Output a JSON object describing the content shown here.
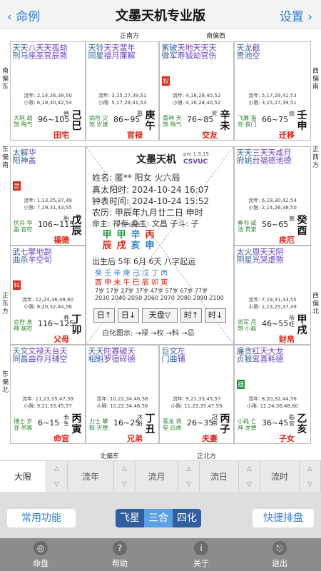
{
  "topbar": {
    "back_label": "‹ 命例",
    "title": "文墨天机专业版",
    "settings_label": "设置 ›"
  },
  "directions": {
    "top_center": "正南方",
    "top_right": "南偏西",
    "left_top": "南偏东",
    "left_mid": "东偏南",
    "left_low": "正东方",
    "left_bottom": "东偏北",
    "right_top": "西偏南",
    "right_mid": "正西方",
    "right_low": "西偏北",
    "bottom_left": "北偏东",
    "bottom_center": "正北方"
  },
  "palaces": [
    {
      "stars": [
        [
          "天",
          "刑"
        ],
        [
          "天",
          "马"
        ],
        [
          "八",
          "座"
        ],
        [
          "天",
          "巫"
        ],
        [
          "天",
          "官"
        ],
        [
          "孤",
          "辰"
        ],
        [
          "劫",
          "煞"
        ]
      ],
      "minor": "大耗 劫煞 晦气",
      "info1": "流年: 2,14,26,38,50",
      "info2": "小限: 6,18,30,42,54",
      "range": "96~105",
      "gz": [
        "己",
        "巳"
      ],
      "ll": "绝",
      "name": "田宅"
    },
    {
      "stars": [
        [
          "天",
          "同"
        ],
        [
          "铃",
          "星"
        ],
        [
          "天",
          "福"
        ],
        [
          "天",
          "月"
        ],
        [
          "蜚",
          "廉"
        ],
        [
          "年",
          "解"
        ]
      ],
      "minor": "病符 灾煞 岁建",
      "info1": "流年: 3,15,27,39,51",
      "info2": "小限: 5,17,29,41,53",
      "range": "86~95",
      "gz": [
        "庚",
        "午"
      ],
      "ll": "墓",
      "name": "官禄"
    },
    {
      "stars": [
        [
          "紫",
          "微"
        ],
        [
          "破",
          "军"
        ],
        [
          "天",
          "寿"
        ],
        [
          "地",
          "钺"
        ],
        [
          "天",
          "劫"
        ],
        [
          "天",
          "官"
        ],
        [
          "天",
          "伤"
        ]
      ],
      "hua": "权",
      "minor": "喜神 天煞 晦气",
      "info1": "流年: 4,16,28,40,52",
      "info2": "小限: 4,16,28,40,52",
      "range": "76~85",
      "gz": [
        "辛",
        "未"
      ],
      "ll": "死",
      "name": "交友"
    },
    {
      "stars": [
        [
          "天",
          "贵"
        ],
        [
          "龙",
          "池"
        ],
        [
          "截",
          "空"
        ]
      ],
      "minor": "飞廉 指背 丧门",
      "info1": "流年: 5,17,29,41,53",
      "info2": "小限: 3,15,27,39,51",
      "range": "66~75",
      "gz": [
        "壬",
        "申"
      ],
      "ll": "病",
      "name": "迁移"
    },
    {
      "stars": [
        [
          "太",
          "阳"
        ],
        [
          "解",
          "神"
        ],
        [
          "华",
          "盖"
        ]
      ],
      "hua": "忌",
      "minor": "伏兵 华盖 官符",
      "info1": "流年: 1,13,25,37,49",
      "info2": "小限: 7,19,31,43,55",
      "range": "106~115",
      "gz": [
        "戊",
        "辰"
      ],
      "ll": "胎",
      "name": "福德"
    },
    {
      "stars": [
        [
          "天",
          "府"
        ],
        [
          "天",
          "姚"
        ],
        [
          "三",
          "台"
        ],
        [
          "天",
          "福"
        ],
        [
          "天",
          "德"
        ],
        [
          "咸",
          "池"
        ],
        [
          "月",
          "德"
        ]
      ],
      "minor": "奏书 咸池 贯索",
      "info1": "流年: 6,18,30,42,54",
      "info2": "小限: 2,14,26,38,50",
      "range": "56~65",
      "gz": [
        "癸",
        "酉"
      ],
      "ll": "衰",
      "name": "疾厄"
    },
    {
      "stars": [
        [
          "武",
          "曲"
        ],
        [
          "七",
          "杀"
        ],
        [
          "擎",
          "羊"
        ],
        [
          "地",
          "空"
        ],
        [
          "副",
          "旬"
        ]
      ],
      "hua": "科",
      "minor": "官符 息神 病符",
      "info1": "流年: 12,24,36,48,60",
      "info2": "小限: 8,20,32,44,56",
      "range": "116~125",
      "gz": [
        "丁",
        "卯"
      ],
      "ll": "养",
      "name": "父母"
    },
    {
      "stars": [
        [
          "太",
          "阴"
        ],
        [
          "火",
          "星"
        ],
        [
          "恩",
          "光"
        ],
        [
          "天",
          "哭"
        ],
        [
          "天",
          "虚"
        ],
        [
          "阴",
          "煞"
        ]
      ],
      "minor": "将军 月煞 小耗",
      "info1": "流年: 7,19,31,43,55",
      "info2": "小限: 1,13,25,37,49",
      "range": "46~55",
      "gz": [
        "甲",
        "戌"
      ],
      "ll": "帝旺",
      "name": "财帛"
    },
    {
      "stars": [
        [
          "天",
          "同"
        ],
        [
          "文",
          "昌"
        ],
        [
          "文",
          "曲"
        ],
        [
          "禄",
          "存"
        ],
        [
          "天",
          "月"
        ],
        [
          "台",
          "辅"
        ],
        [
          "天",
          "空"
        ]
      ],
      "minor": "博士 岁驿 吊客",
      "info1": "流年: 11,23,35,47,59",
      "info2": "小限: 9,21,33,45,57",
      "range": "6~15",
      "gz": [
        "丙",
        "寅"
      ],
      "ll": "长生",
      "name": "命宫"
    },
    {
      "stars": [
        [
          "天",
          "相"
        ],
        [
          "天",
          "魁"
        ],
        [
          "陀",
          "罗"
        ],
        [
          "寡",
          "宿"
        ],
        [
          "破",
          "碎"
        ],
        [
          "天",
          "德"
        ]
      ],
      "minor": "力士 攀鞍 天德",
      "info1": "流年: 10,22,34,46,58",
      "info2": "小限: 10,22,34,46,58",
      "range": "16~25",
      "gz": [
        "丁",
        "丑"
      ],
      "ll": "沐浴",
      "name": "兄弟"
    },
    {
      "stars": [
        [
          "巨",
          "门"
        ],
        [
          "文",
          "曲"
        ],
        [
          "左",
          "辅"
        ]
      ],
      "minor": "青龙 将星 白虎",
      "info1": "流年: 9,21,33,45,57",
      "info2": "小限: 11,23,35,47,59",
      "range": "26~35",
      "gz": [
        "丙",
        "子"
      ],
      "ll": "冠带",
      "name": "夫妻"
    },
    {
      "stars": [
        [
          "廉",
          "贞"
        ],
        [
          "贪",
          "狼"
        ],
        [
          "红",
          "鸾"
        ],
        [
          "天",
          "喜"
        ],
        [
          "大",
          "耗"
        ],
        [
          "龙",
          "德"
        ]
      ],
      "hua": "禄",
      "minor": "小耗 亡神 龙德",
      "info1": "流年: 8,20,32,44,56",
      "info2": "小限: 12,24,36,48,60",
      "range": "36~45",
      "gz": [
        "乙",
        "亥"
      ],
      "ll": "临官",
      "name": "子女"
    }
  ],
  "center": {
    "title": "文墨天机",
    "pro": "pro 1.9.15",
    "csvuc": "CSVUC",
    "name_line": "姓名: 匿**     阳女 火六局",
    "solar_line": "真太阳时: 2024-10-24 16:07",
    "clock_line": "钟表时间: 2024-10-24 15:52",
    "lunar_line": "农历: 甲辰年九月廿二日 申时",
    "master_line": "命主: 禄存 身主: 文昌 子斗: 子",
    "pillar_label": "节气四柱",
    "pillars_top": [
      "甲",
      "甲",
      "辛",
      "丙"
    ],
    "pillars_bottom": [
      "辰",
      "戌",
      "亥",
      "申"
    ],
    "luck_line": "出生后 5年 6月 6天 八字起运",
    "luck_stems": "癸 壬 辛 庚 己 戊 丁 丙",
    "luck_branches": "酉 申 未 午 巳 辰 卯 寅",
    "luck_ages": "7岁 17岁 27岁 37岁 47岁 57岁 67岁 77岁",
    "luck_years": "2030 2040 2050 2060 2070 2080 2090 2100",
    "nav": [
      "日↑",
      "日↓",
      "天盘▽",
      "时↑",
      "时↓"
    ],
    "legend": "白化图示: →禄 →权 →科 →忌"
  },
  "selector": [
    "大限",
    "流年",
    "流月",
    "流日",
    "流时"
  ],
  "func": {
    "common": "常用功能",
    "seg": [
      "飞星",
      "三合",
      "四化"
    ],
    "quick": "快捷排盘"
  },
  "tabs": [
    {
      "icon": "◎",
      "label": "命盘"
    },
    {
      "icon": "?",
      "label": "帮助"
    },
    {
      "icon": "i",
      "label": "关于"
    },
    {
      "icon": "⎋",
      "label": "退出"
    }
  ],
  "colors": {
    "accent": "#2f7fd3",
    "hua_red": "#d21",
    "lu_green": "#1e9a3a",
    "ke_magenta": "#c028a0",
    "quan_purple": "#6a3fc0"
  }
}
